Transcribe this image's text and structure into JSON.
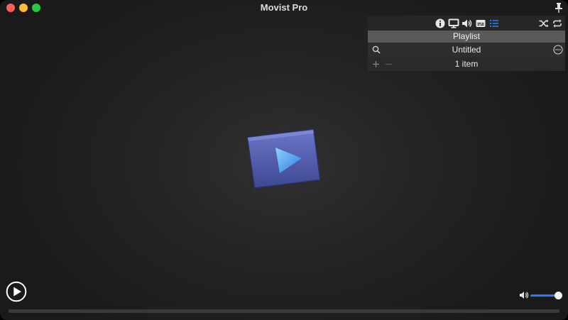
{
  "window": {
    "title": "Movist Pro",
    "traffic_lights": {
      "close_color": "#fe5f57",
      "minimize_color": "#febc2e",
      "zoom_color": "#28c840"
    },
    "pin_icon": "pin-icon"
  },
  "panel": {
    "toolbar_icons": [
      "info-icon",
      "display-icon",
      "audio-icon",
      "subtitle-icon",
      "playlist-icon",
      "shuffle-icon",
      "repeat-icon"
    ],
    "active_icon": "playlist-icon",
    "accent": "#2a7bff",
    "header": "Playlist",
    "playlist_title": "Untitled",
    "item_count": "1 item"
  },
  "player": {
    "logo": "movist-logo",
    "volume": 0.85,
    "progress": 0
  }
}
